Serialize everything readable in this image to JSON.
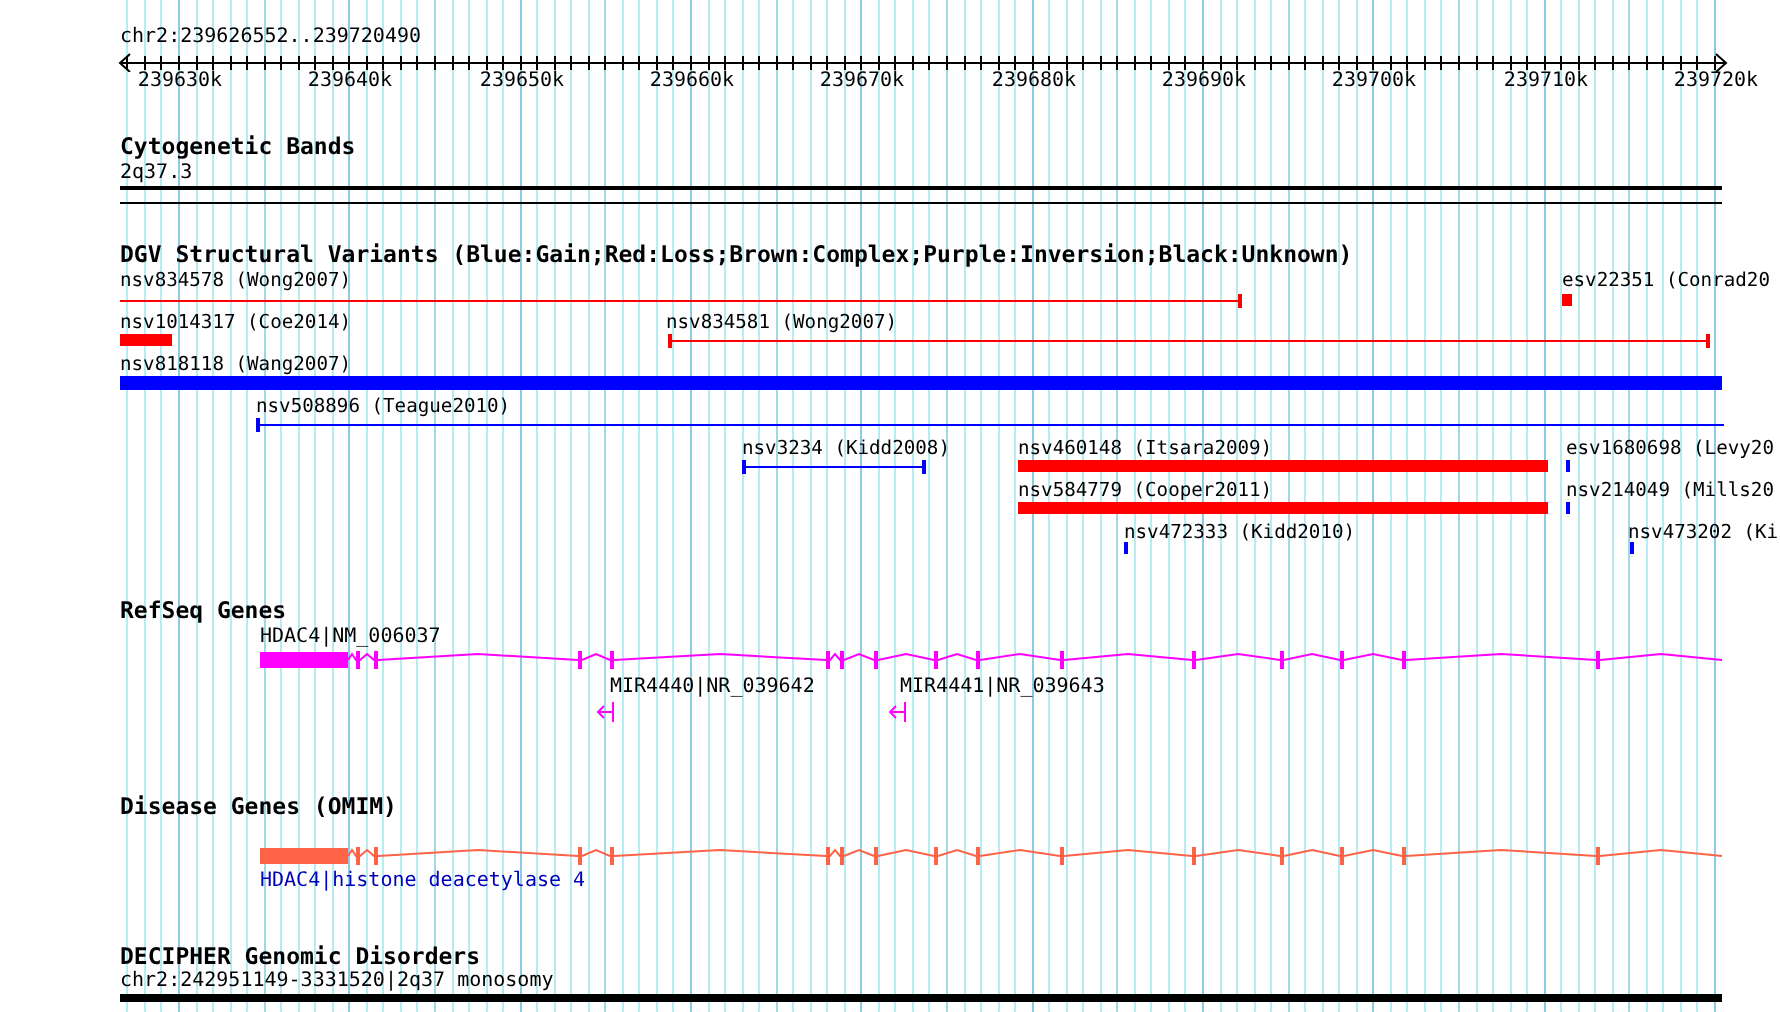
{
  "ruler": {
    "region": "chr2:239626552..239720490",
    "ticks": [
      "239630k",
      "239640k",
      "239650k",
      "239660k",
      "239670k",
      "239680k",
      "239690k",
      "239700k",
      "239710k",
      "239720k"
    ]
  },
  "tracks": [
    {
      "kind": "cytoband",
      "title": "Cytogenetic Bands",
      "label": "2q37.3"
    },
    {
      "kind": "variants",
      "title": "DGV Structural Variants (Blue:Gain;Red:Loss;Brown:Complex;Purple:Inversion;Black:Unknown)",
      "variants": [
        {
          "label": "nsv834578 (Wong2007)",
          "color": "#ff0000",
          "kind": "line"
        },
        {
          "label": "esv22351 (Conrad20",
          "color": "#ff0000",
          "kind": "bar"
        },
        {
          "label": "nsv1014317 (Coe2014)",
          "color": "#ff0000",
          "kind": "bar"
        },
        {
          "label": "nsv834581 (Wong2007)",
          "color": "#ff0000",
          "kind": "line"
        },
        {
          "label": "nsv818118 (Wang2007)",
          "color": "#0000ff",
          "kind": "bar"
        },
        {
          "label": "nsv508896 (Teague2010)",
          "color": "#0000ff",
          "kind": "line"
        },
        {
          "label": "nsv3234 (Kidd2008)",
          "color": "#0000ff",
          "kind": "line"
        },
        {
          "label": "nsv460148 (Itsara2009)",
          "color": "#ff0000",
          "kind": "bar"
        },
        {
          "label": "esv1680698 (Levy20",
          "color": "#0000ff",
          "kind": "bar"
        },
        {
          "label": "nsv584779 (Cooper2011)",
          "color": "#ff0000",
          "kind": "bar"
        },
        {
          "label": "nsv214049 (Mills20",
          "color": "#0000ff",
          "kind": "bar"
        },
        {
          "label": "nsv472333 (Kidd2010)",
          "color": "#0000ff",
          "kind": "bar"
        },
        {
          "label": "nsv473202 (Ki",
          "color": "#0000ff",
          "kind": "bar"
        }
      ]
    },
    {
      "kind": "refseq",
      "title": "RefSeq Genes",
      "genes": [
        {
          "label": "HDAC4|NM_006037",
          "kind": "gene"
        },
        {
          "label": "MIR4440|NR_039642",
          "kind": "mirna"
        },
        {
          "label": "MIR4441|NR_039643",
          "kind": "mirna"
        }
      ]
    },
    {
      "kind": "omim",
      "title": "Disease Genes (OMIM)",
      "genes": [
        {
          "label": "HDAC4|histone deacetylase 4",
          "kind": "gene"
        }
      ]
    },
    {
      "kind": "decipher",
      "title": "DECIPHER Genomic Disorders",
      "label": "chr2:242951149-3331520|2q37 monosomy"
    }
  ]
}
